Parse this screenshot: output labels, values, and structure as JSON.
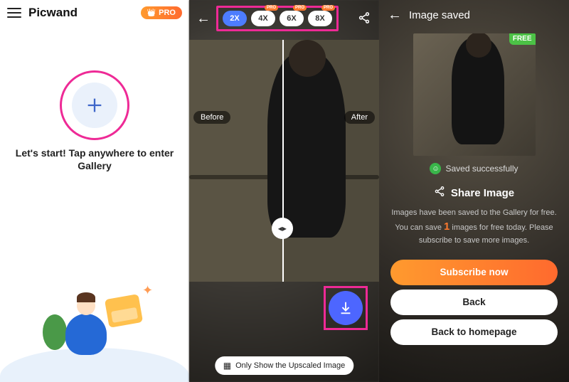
{
  "panel1": {
    "brand": "Picwand",
    "pro_label": "PRO",
    "start_text": "Let's start! Tap anywhere to enter Gallery"
  },
  "panel2": {
    "back_icon": "←",
    "scales": [
      {
        "label": "2X",
        "active": true,
        "pro": false
      },
      {
        "label": "4X",
        "active": false,
        "pro": true
      },
      {
        "label": "6X",
        "active": false,
        "pro": true
      },
      {
        "label": "8X",
        "active": false,
        "pro": true
      }
    ],
    "share_icon": "share",
    "before_label": "Before",
    "after_label": "After",
    "only_upscaled_label": "Only Show the Upscaled Image"
  },
  "panel3": {
    "back_icon": "←",
    "title": "Image saved",
    "free_tag": "FREE",
    "saved_status": "Saved successfully",
    "share_label": "Share Image",
    "desc_pre": "Images have been saved to the Gallery for free. You can save ",
    "desc_count": "1",
    "desc_post": " images for free today. Please subscribe to save more images.",
    "subscribe_label": "Subscribe now",
    "back_label": "Back",
    "home_label": "Back to homepage"
  },
  "mini_pro": "PRO"
}
